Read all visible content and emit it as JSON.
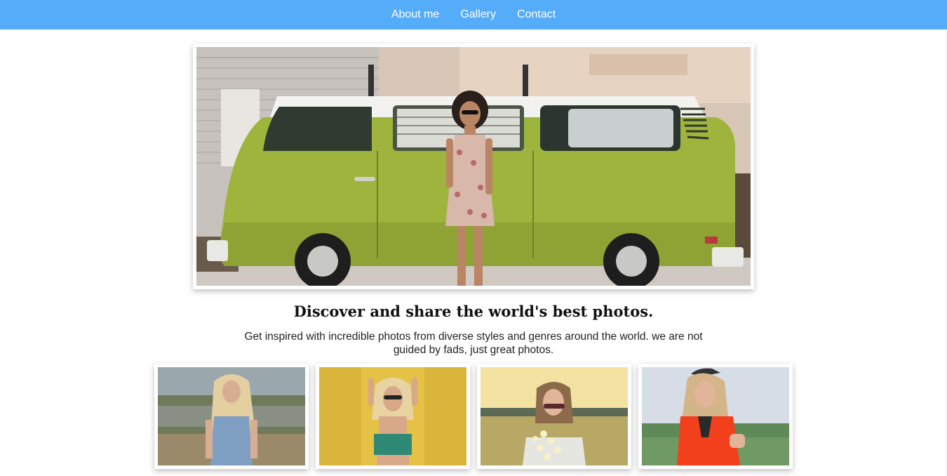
{
  "nav": {
    "items": [
      {
        "label": "About me"
      },
      {
        "label": "Gallery"
      },
      {
        "label": "Contact"
      }
    ],
    "background_color": "#55acf8"
  },
  "hero": {
    "image_icon": "hero-photo-van"
  },
  "headline": "Discover and share the world's best photos.",
  "subtext": "Get inspired with incredible photos from diverse styles and genres around the world. we are not guided by fads, just great photos.",
  "gallery": {
    "thumbnails": [
      {
        "icon": "photo-blonde-field"
      },
      {
        "icon": "photo-yellow-wall"
      },
      {
        "icon": "photo-sunset-flowers"
      },
      {
        "icon": "photo-red-sweater"
      }
    ]
  }
}
